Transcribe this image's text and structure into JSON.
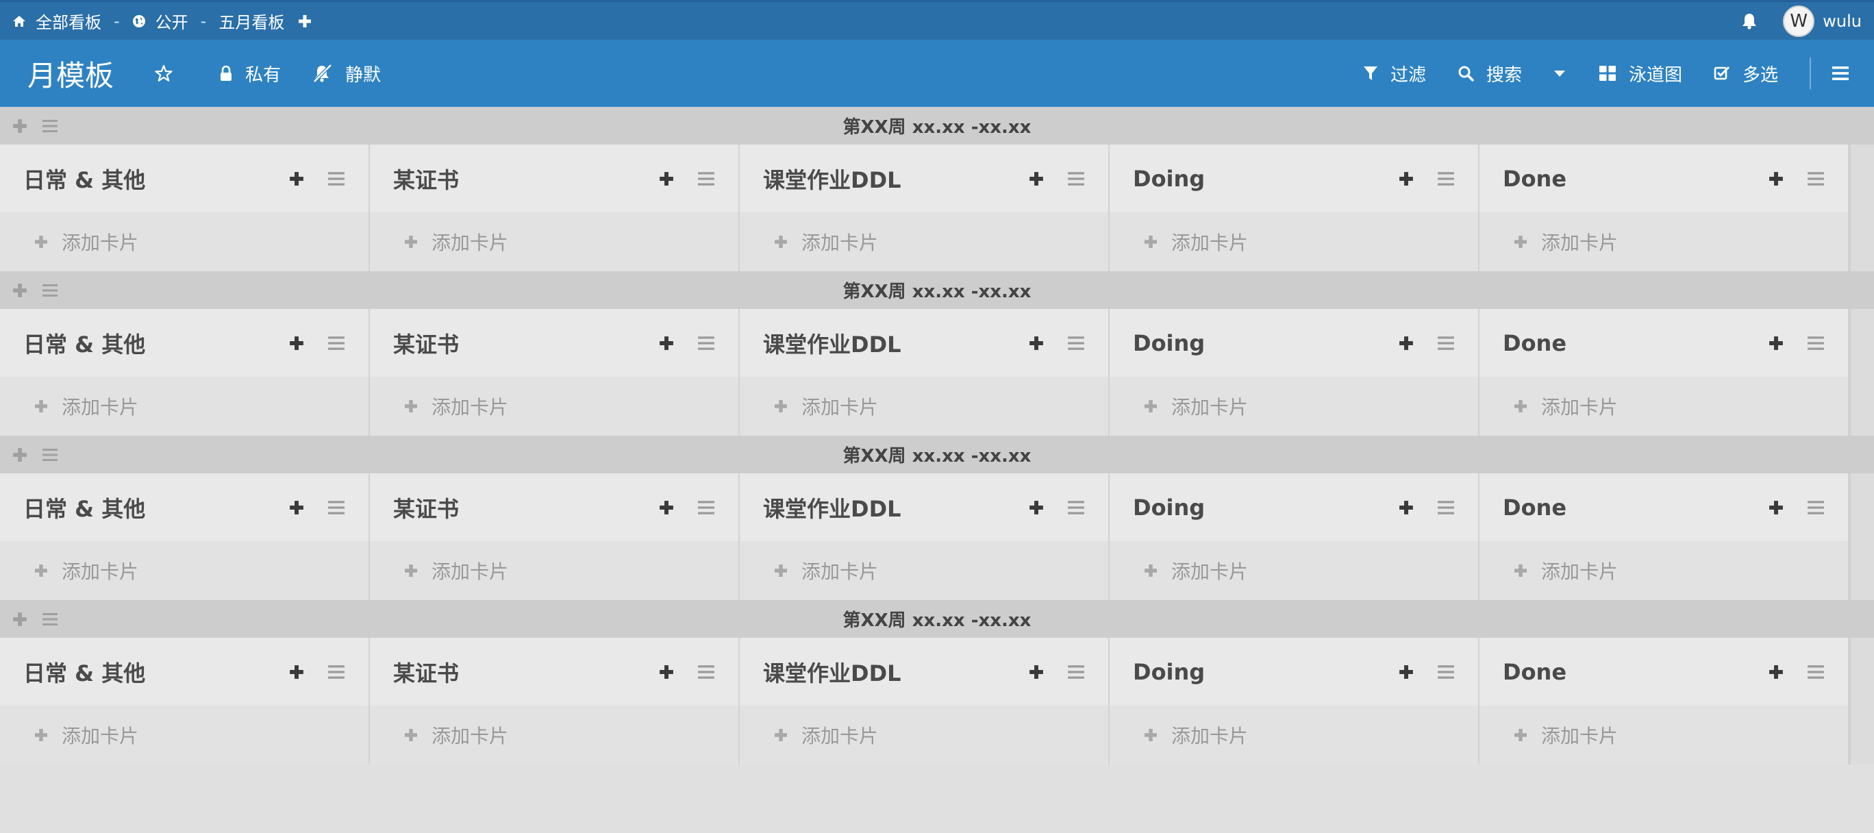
{
  "topbar": {
    "all_boards": "全部看板",
    "sep1": "-",
    "visibility": "公开",
    "sep2": "-",
    "board_name": "五月看板",
    "username": "wulu",
    "avatar_initial": "W"
  },
  "board": {
    "title": "月模板",
    "private_label": "私有",
    "mute_label": "静默",
    "filter_label": "过滤",
    "search_label": "搜索",
    "view_label": "泳道图",
    "multiselect_label": "多选"
  },
  "colors": {
    "topbar_bg": "#2a6fa8",
    "boardbar_bg": "#2e82c2",
    "lane_header_bg": "#cdcdcd",
    "list_header_bg": "#e9e9e9"
  },
  "swimlanes": [
    {
      "title": "第XX周 xx.xx -xx.xx",
      "lists": [
        {
          "title": "日常 & 其他",
          "add_card": "添加卡片"
        },
        {
          "title": "某证书",
          "add_card": "添加卡片"
        },
        {
          "title": "课堂作业DDL",
          "add_card": "添加卡片"
        },
        {
          "title": "Doing",
          "add_card": "添加卡片"
        },
        {
          "title": "Done",
          "add_card": "添加卡片"
        }
      ]
    },
    {
      "title": "第XX周 xx.xx -xx.xx",
      "lists": [
        {
          "title": "日常 & 其他",
          "add_card": "添加卡片"
        },
        {
          "title": "某证书",
          "add_card": "添加卡片"
        },
        {
          "title": "课堂作业DDL",
          "add_card": "添加卡片"
        },
        {
          "title": "Doing",
          "add_card": "添加卡片"
        },
        {
          "title": "Done",
          "add_card": "添加卡片"
        }
      ]
    },
    {
      "title": "第XX周 xx.xx -xx.xx",
      "lists": [
        {
          "title": "日常 & 其他",
          "add_card": "添加卡片"
        },
        {
          "title": "某证书",
          "add_card": "添加卡片"
        },
        {
          "title": "课堂作业DDL",
          "add_card": "添加卡片"
        },
        {
          "title": "Doing",
          "add_card": "添加卡片"
        },
        {
          "title": "Done",
          "add_card": "添加卡片"
        }
      ]
    },
    {
      "title": "第XX周 xx.xx -xx.xx",
      "lists": [
        {
          "title": "日常 & 其他",
          "add_card": "添加卡片"
        },
        {
          "title": "某证书",
          "add_card": "添加卡片"
        },
        {
          "title": "课堂作业DDL",
          "add_card": "添加卡片"
        },
        {
          "title": "Doing",
          "add_card": "添加卡片"
        },
        {
          "title": "Done",
          "add_card": "添加卡片"
        }
      ]
    }
  ]
}
